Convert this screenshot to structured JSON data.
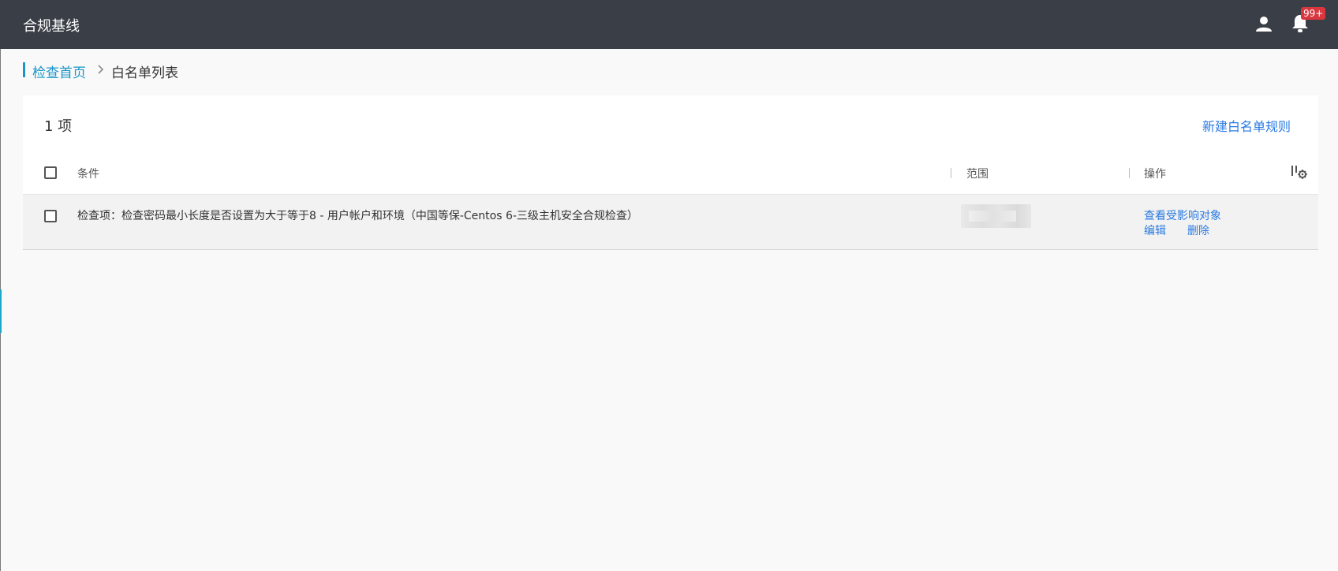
{
  "header": {
    "title": "合规基线",
    "user_icon": "user-icon",
    "bell_icon": "bell-icon",
    "notification_count": "99+"
  },
  "breadcrumb": {
    "home": "检查首页",
    "separator_icon": "chevron-right-icon",
    "current": "白名单列表"
  },
  "list": {
    "count_label": "1 项",
    "new_button_label": "新建白名单规则",
    "columns": {
      "condition": "条件",
      "scope": "范围",
      "actions": "操作"
    },
    "column_settings_icon": "column-settings-icon",
    "rows": [
      {
        "condition": "检查项：检查密码最小长度是否设置为大于等于8 - 用户帐户和环境（中国等保-Centos 6-三级主机安全合规检查）",
        "actions": {
          "view_affected": "查看受影响对象",
          "edit": "编辑",
          "delete": "删除"
        }
      }
    ]
  },
  "colors": {
    "topbar": "#3a3f47",
    "link": "#2a7ae2",
    "breadcrumb_accent": "#1a95c8",
    "badge": "#d9363e"
  }
}
